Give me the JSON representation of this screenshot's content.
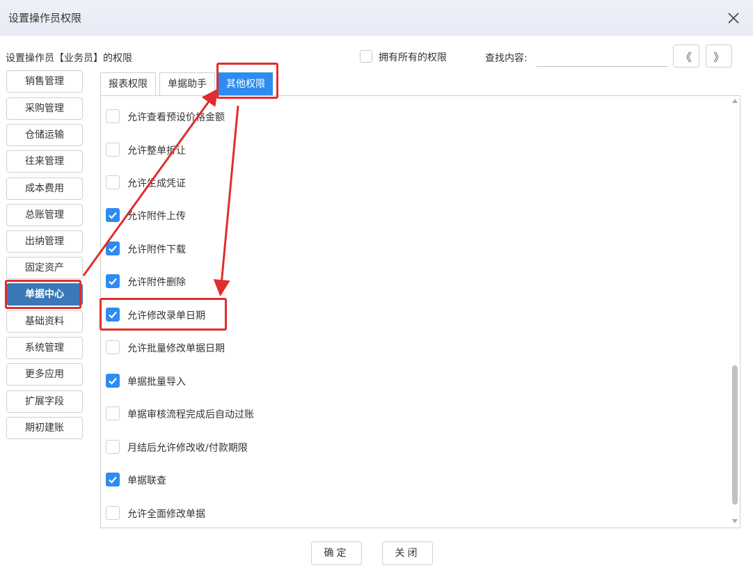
{
  "window": {
    "title": "设置操作员权限"
  },
  "header": {
    "label": "设置操作员【业务员】的权限",
    "all_permissions_label": "拥有所有的权限",
    "search_label": "查找内容:",
    "search_value": "",
    "prev_label": "《",
    "next_label": "》"
  },
  "sidebar": {
    "items": [
      {
        "label": "销售管理"
      },
      {
        "label": "采购管理"
      },
      {
        "label": "仓储运输"
      },
      {
        "label": "往来管理"
      },
      {
        "label": "成本费用"
      },
      {
        "label": "总账管理"
      },
      {
        "label": "出纳管理"
      },
      {
        "label": "固定资产"
      },
      {
        "label": "单据中心",
        "active": true
      },
      {
        "label": "基础资料"
      },
      {
        "label": "系统管理"
      },
      {
        "label": "更多应用"
      },
      {
        "label": "扩展字段"
      },
      {
        "label": "期初建账"
      }
    ]
  },
  "tabs": [
    {
      "label": "报表权限"
    },
    {
      "label": "单据助手"
    },
    {
      "label": "其他权限",
      "active": true
    }
  ],
  "permissions": [
    {
      "label": "允许查看预设价格金额",
      "checked": false
    },
    {
      "label": "允许整单折让",
      "checked": false
    },
    {
      "label": "允许生成凭证",
      "checked": false
    },
    {
      "label": "允许附件上传",
      "checked": true
    },
    {
      "label": "允许附件下载",
      "checked": true
    },
    {
      "label": "允许附件删除",
      "checked": true
    },
    {
      "label": "允许修改录单日期",
      "checked": true
    },
    {
      "label": "允许批量修改单据日期",
      "checked": false
    },
    {
      "label": "单据批量导入",
      "checked": true
    },
    {
      "label": "单据审核流程完成后自动过账",
      "checked": false
    },
    {
      "label": "月结后允许修改收/付款期限",
      "checked": false
    },
    {
      "label": "单据联查",
      "checked": true
    },
    {
      "label": "允许全面修改单据",
      "checked": false
    }
  ],
  "footer": {
    "confirm_label": "确定",
    "close_label": "关闭"
  },
  "colors": {
    "accent": "#2e8bf0",
    "sidebar_active": "#3a78b7",
    "annotation": "#e02d2d"
  }
}
